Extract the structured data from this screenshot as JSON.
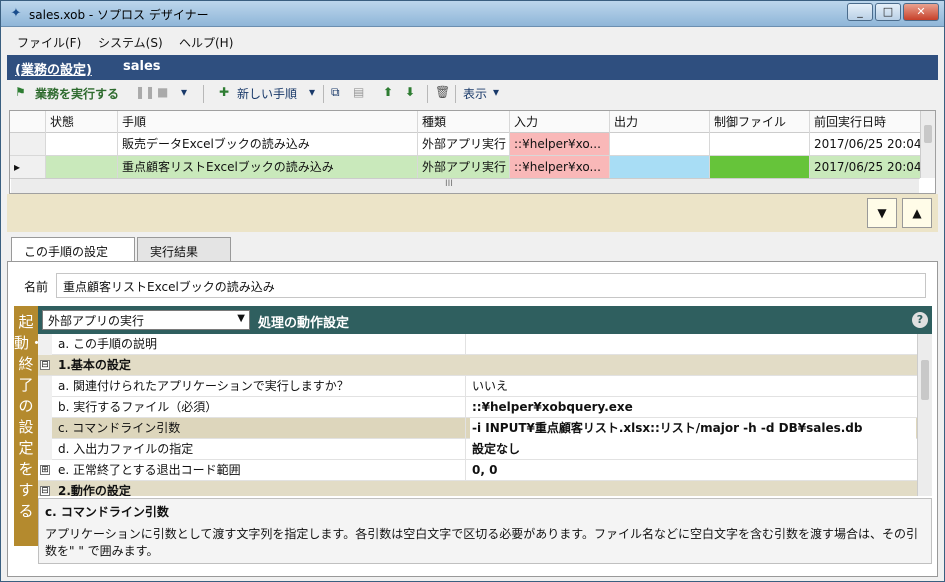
{
  "window": {
    "title": "sales.xob - ソプロス デザイナー",
    "min": "_",
    "max": "□",
    "close": "✕"
  },
  "menu": [
    "ファイル(F)",
    "システム(S)",
    "ヘルプ(H)"
  ],
  "header": {
    "section_link": "(業務の設定)",
    "name": "sales"
  },
  "toolbar": {
    "run_label": "業務を実行する",
    "pause": "❚❚",
    "stop": "■",
    "dropdown": "▾",
    "new_step_label": "新しい手順",
    "view_label": "表示"
  },
  "grid": {
    "columns": [
      "状態",
      "手順",
      "種類",
      "入力",
      "出力",
      "制御ファイル",
      "前回実行日時"
    ],
    "rows": [
      {
        "indicator": "",
        "state": "",
        "step": "販売データExcelブックの読み込み",
        "type": "外部アプリ実行",
        "input": "::¥helper¥xo...",
        "output": "",
        "control": "",
        "last_run": "2017/06/25 20:04:"
      },
      {
        "indicator": "▸",
        "state": "",
        "step": "重点顧客リストExcelブックの読み込み",
        "type": "外部アプリ実行",
        "input": "::¥helper¥xo...",
        "output": "",
        "control": "",
        "last_run": "2017/06/25 20:04:"
      }
    ],
    "hscroll_label": "III"
  },
  "nav": {
    "down": "▼",
    "up": "▲"
  },
  "tabs": [
    "この手順の設定",
    "実行結果"
  ],
  "step_settings": {
    "name_label": "名前",
    "name_value": "重点顧客リストExcelブックの読み込み",
    "vertical_band": "起動・終了の設定をする",
    "action_select": "外部アプリの実行",
    "panel_title": "処理の動作設定",
    "help": "?",
    "properties": [
      {
        "kind": "item",
        "key": "a. この手順の説明",
        "value": ""
      },
      {
        "kind": "cat",
        "key": "1.基本の設定",
        "expander": "⊟"
      },
      {
        "kind": "item",
        "key": "a. 関連付けられたアプリケーションで実行しますか？",
        "value": "いいえ"
      },
      {
        "kind": "item",
        "key": "b. 実行するファイル（必須）",
        "value": "::¥helper¥xobquery.exe"
      },
      {
        "kind": "sel",
        "key": "c. コマンドライン引数",
        "value": "-i INPUT¥重点顧客リスト.xlsx::リスト/major -h -d DB¥sales.db"
      },
      {
        "kind": "item",
        "key": "d. 入出力ファイルの指定",
        "value": "設定なし"
      },
      {
        "kind": "item",
        "key": "e. 正常終了とする退出コード範囲",
        "value": "0, 0",
        "expander": "⊞"
      },
      {
        "kind": "cat",
        "key": "2.動作の設定",
        "expander": "⊟"
      }
    ],
    "description_title": "c. コマンドライン引数",
    "description_text": "アプリケーションに引数として渡す文字列を指定します。各引数は空白文字で区切る必要があります。ファイル名などに空白文字を含む引数を渡す場合は、その引数を\" \" で囲みます。"
  },
  "colors": {
    "header_band": "#2f4f7f",
    "input_cell": "#f9b8b8",
    "output_cell": "#a8ddf5",
    "control_cell": "#66c43a",
    "selected_row": "#c9e9bb",
    "vband": "#b48a2e",
    "prop_header": "#2f5f5f"
  }
}
